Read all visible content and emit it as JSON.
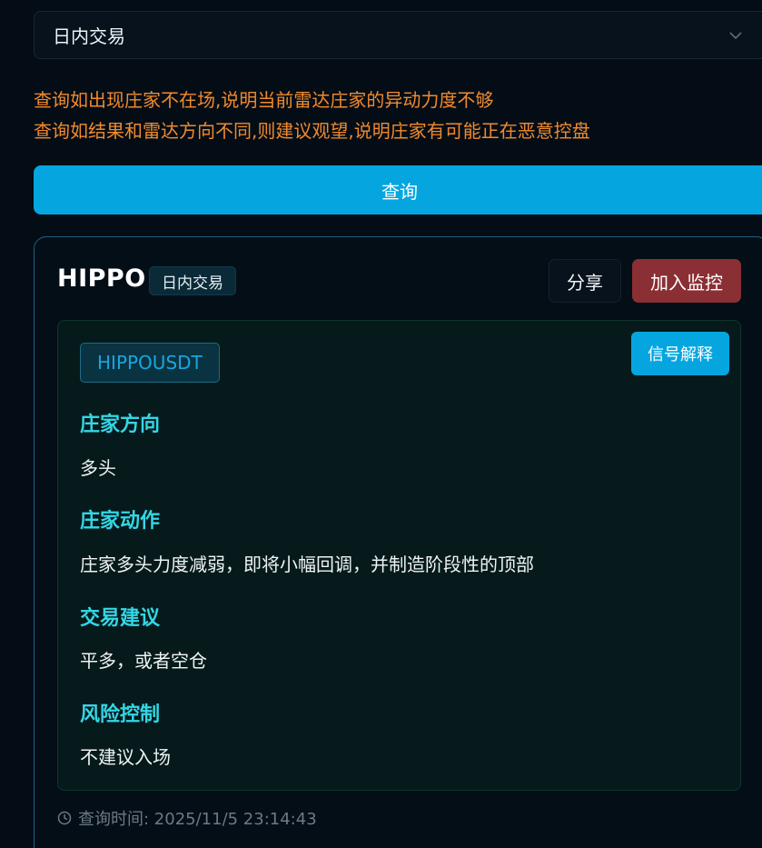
{
  "mode_select": {
    "value": "日内交易",
    "icon": "chevron-down-icon"
  },
  "notices": [
    "查询如出现庄家不在场,说明当前雷达庄家的异动力度不够",
    "查询如结果和雷达方向不同,则建议观望,说明庄家有可能正在恶意控盘"
  ],
  "query_button": "查询",
  "result": {
    "title": "HIPPO",
    "mode_tag": "日内交易",
    "share_label": "分享",
    "monitor_label": "加入监控",
    "symbol": "HIPPOUSDT",
    "explain_label": "信号解释",
    "sections": [
      {
        "title": "庄家方向",
        "text": "多头"
      },
      {
        "title": "庄家动作",
        "text": "庄家多头力度减弱，即将小幅回调，并制造阶段性的顶部"
      },
      {
        "title": "交易建议",
        "text": "平多，或者空仓"
      },
      {
        "title": "风险控制",
        "text": "不建议入场"
      }
    ],
    "query_time": "查询时间: 2025/11/5 23:14:43",
    "time_icon": "clock-icon"
  },
  "colors": {
    "background": "#040d16",
    "accent": "#05a6e0",
    "warning_text": "#f08a2e",
    "section_title": "#34d6e6",
    "monitor_button": "#8a2f34"
  }
}
